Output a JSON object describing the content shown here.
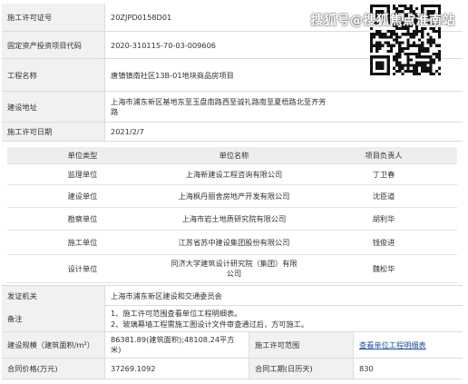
{
  "watermark": "搜狐号@搜狐焦点淮南站",
  "permit": {
    "construction_permit_no_label": "施工许可证号",
    "construction_permit_no": "20ZJPD0158D01",
    "fixed_asset_code_label": "固定资产投资项目代码",
    "fixed_asset_code": "2020-310115-70-03-009606",
    "project_name_label": "工程名称",
    "project_name": "唐镇镇南社区13B-01地块商品房项目",
    "address_label": "建设地址",
    "address_line1": "上海市浦东新区基地东至玉盘南路西至诚礼路南至夏梧路北至齐芳",
    "address_line2": "路",
    "date_label": "施工许可日期",
    "date": "2021/2/7"
  },
  "units_table": {
    "headers": [
      "单位类型",
      "单位名称",
      "项目负责人"
    ],
    "rows": [
      {
        "type": "监理单位",
        "name": "上海新建设工程咨询有限公司",
        "lead": "丁卫春"
      },
      {
        "type": "建设单位",
        "name": "上海枫丹丽舍房地产开发有限公司",
        "lead": "沈臣道"
      },
      {
        "type": "勘察单位",
        "name": "上海市岩土地质研究院有限公司",
        "lead": "胡利华"
      },
      {
        "type": "施工单位",
        "name": "江苏省苏中建设集团股份有限公司",
        "lead": "钱俊进"
      },
      {
        "type": "设计单位",
        "name_line1": "同济大学建筑设计研究院（集团）有限",
        "name_line2": "公司",
        "lead": "魏松华"
      }
    ]
  },
  "issuer_label": "发证机关",
  "issuer": "上海市浦东新区建设和交通委员会",
  "remarks_label": "备注",
  "remarks_line1": "1、施工许可范围查看单位工程明细表。",
  "remarks_line2": "2、玻璃幕墙工程需施工图设计文件审查通过后，方可施工。",
  "scale_label": "建设规模（建筑面积/m²）",
  "scale_line1": "86381.89(建筑面积);48108.24平方",
  "scale_line2": "米)",
  "scope_label": "施工许可范围",
  "scope_link": "查看单位工程明细表",
  "price_label": "合同价格(万元)",
  "price": "37269.1092",
  "duration_label": "合同工期(日历天)",
  "duration": "830"
}
